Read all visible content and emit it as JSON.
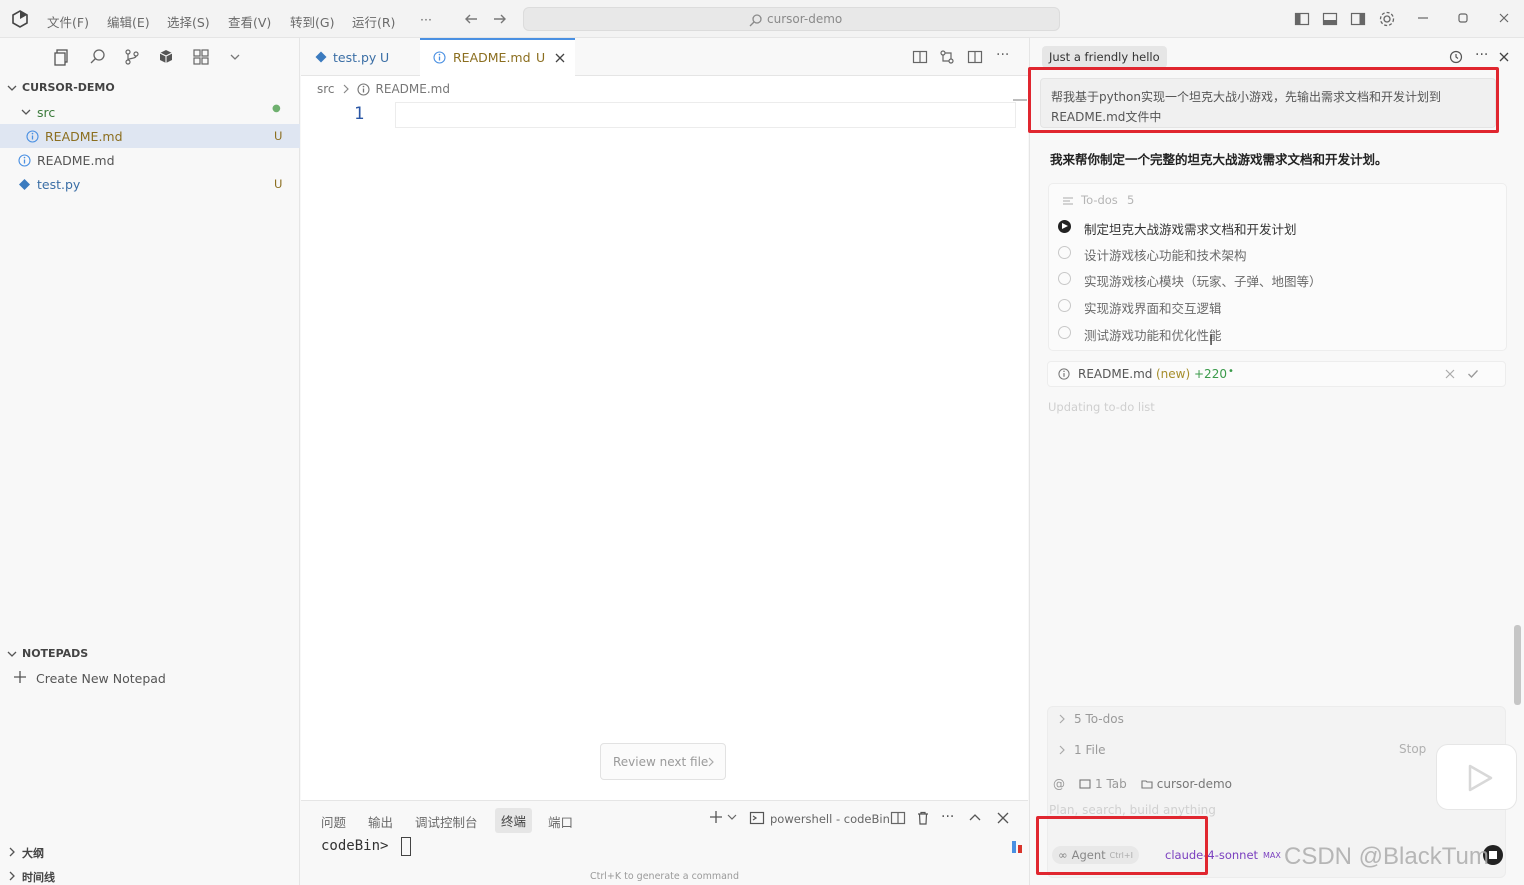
{
  "titlebar": {
    "menu": [
      "文件(F)",
      "编辑(E)",
      "选择(S)",
      "查看(V)",
      "转到(G)",
      "运行(R)",
      "···"
    ],
    "search_text": "cursor-demo"
  },
  "sidebar": {
    "section_title": "CURSOR-DEMO",
    "items": [
      {
        "label": "src",
        "badge": "●"
      },
      {
        "label": "README.md",
        "badge": "U"
      },
      {
        "label": "README.md",
        "badge": ""
      },
      {
        "label": "test.py",
        "badge": "U"
      }
    ],
    "notepads_title": "NOTEPADS",
    "create_notepad": "Create New Notepad",
    "outline": "大纲",
    "timeline": "时间线"
  },
  "tabs": [
    {
      "label": "test.py",
      "badge": "U"
    },
    {
      "label": "README.md",
      "badge": "U"
    }
  ],
  "breadcrumb": {
    "folder": "src",
    "file": "README.md"
  },
  "editor": {
    "line_number": "1",
    "review_button": "Review next file"
  },
  "panel": {
    "tabs": [
      "问题",
      "输出",
      "调试控制台",
      "终端",
      "端口"
    ],
    "terminal_name": "powershell - codeBin",
    "prompt": "codeBin>",
    "hint": "Ctrl+K to generate a command"
  },
  "chat": {
    "tab_title": "Just a friendly hello",
    "user_message": "帮我基于python实现一个坦克大战小游戏，先输出需求文档和开发计划到README.md文件中",
    "reply": "我来帮你制定一个完整的坦克大战游戏需求文档和开发计划。",
    "todos_header": "To-dos",
    "todos_count": "5",
    "todos": [
      {
        "label": "制定坦克大战游戏需求文档和开发计划",
        "status": "in_progress"
      },
      {
        "label": "设计游戏核心功能和技术架构",
        "status": "pending"
      },
      {
        "label": "实现游戏核心模块（玩家、子弹、地图等）",
        "status": "pending"
      },
      {
        "label": "实现游戏界面和交互逻辑",
        "status": "pending"
      },
      {
        "label": "测试游戏功能和优化性能",
        "status": "pending"
      }
    ],
    "file_change": {
      "name": "README.md",
      "tag": "(new)",
      "delta": "+220"
    },
    "status": "Updating to-do list",
    "summary_todos": "5 To-dos",
    "summary_files": "1 File",
    "stop": "Stop",
    "context_tab": "1 Tab",
    "context_folder": "cursor-demo",
    "placeholder": "Plan, search, build anything",
    "mode": "Agent",
    "mode_shortcut": "Ctrl+I",
    "model": "claude-4-sonnet",
    "max": "MAX"
  },
  "watermark": "CSDN @BlackTum",
  "colors": {
    "accent": "#4a90e2",
    "highlight": "#e0262f",
    "untracked": "#8b6e1f"
  }
}
